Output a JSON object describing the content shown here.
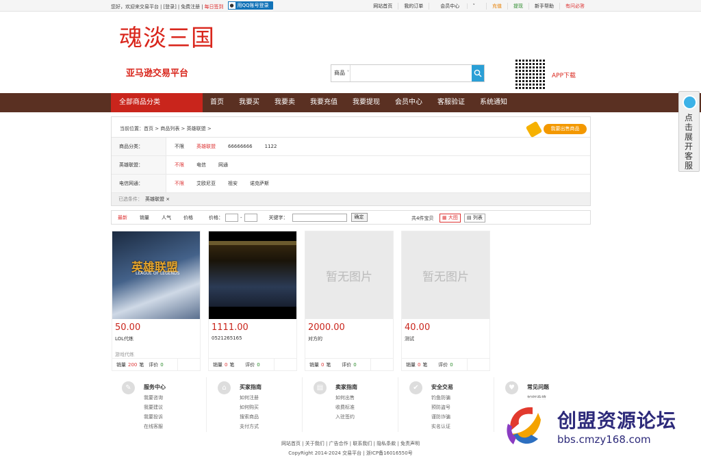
{
  "topbar": {
    "welcome": "您好，欢迎来交易平台",
    "login": "[登录]",
    "register": "免费注册",
    "daily": "每日签到",
    "qq_login": "用QQ账号登录",
    "links": [
      "网站首页",
      "我的订单",
      "会员中心",
      "充值",
      "提现",
      "新手帮助",
      "有问必答"
    ]
  },
  "header": {
    "logo": "魂淡三国",
    "subtitle": "亚马逊交易平台",
    "search_scope": "商品",
    "search_placeholder": "",
    "app_download": "APP下载"
  },
  "nav": {
    "category_label": "全部商品分类",
    "items": [
      "首页",
      "我要买",
      "我要卖",
      "我要充值",
      "我要提现",
      "会员中心",
      "客服验证",
      "系统通知"
    ]
  },
  "breadcrumb": "当前位置：首页 > 商品列表 > 英雄联盟 >",
  "sell_button": "我要出售商品",
  "filters": [
    {
      "key": "商品分类：",
      "values": [
        "不限",
        "英雄联盟",
        "66666666",
        "1122"
      ],
      "active": 1
    },
    {
      "key": "英雄联盟：",
      "values": [
        "不限",
        "电信",
        "网通"
      ],
      "active": 0
    },
    {
      "key": "电信网通：",
      "values": [
        "不限",
        "艾欧尼亚",
        "祖安",
        "诺克萨斯"
      ],
      "active": 0
    }
  ],
  "selected": {
    "label": "已选条件：",
    "tag": "英雄联盟 ×"
  },
  "sorter": {
    "tabs": [
      "最新",
      "销量",
      "人气",
      "价格"
    ],
    "price_label": "价格：",
    "dash": "-",
    "keyword_label": "关键字：",
    "confirm": "确定",
    "count": "共4件宝贝",
    "view_grid": "▦ 大图",
    "view_list": "▤ 列表"
  },
  "products": [
    {
      "price": "50.00",
      "name": "LOL代练",
      "tag": "游戏代练",
      "sales_label": "销量",
      "sales": "200",
      "sales_unit": "笔",
      "rating_label": "评价",
      "rating": "0",
      "image": "lol",
      "img_text": "英雄联盟",
      "img_sub": "LEAGUE OF LEGENDS"
    },
    {
      "price": "1111.00",
      "name": "0521265165",
      "tag": "",
      "sales_label": "销量",
      "sales": "0",
      "sales_unit": "笔",
      "rating_label": "评价",
      "rating": "0",
      "image": "screenshot",
      "img_text": "",
      "img_sub": ""
    },
    {
      "price": "2000.00",
      "name": "对方的",
      "tag": "",
      "sales_label": "销量",
      "sales": "0",
      "sales_unit": "笔",
      "rating_label": "评价",
      "rating": "0",
      "image": "none",
      "img_text": "暂无图片",
      "img_sub": ""
    },
    {
      "price": "40.00",
      "name": "测试",
      "tag": "",
      "sales_label": "销量",
      "sales": "0",
      "sales_unit": "笔",
      "rating_label": "评价",
      "rating": "0",
      "image": "none",
      "img_text": "暂无图片",
      "img_sub": ""
    }
  ],
  "footer_cols": [
    {
      "icon": "✎",
      "title": "服务中心",
      "items": [
        "我要咨询",
        "我要建议",
        "我要投诉",
        "在线客服"
      ]
    },
    {
      "icon": "⌂",
      "title": "买家指南",
      "items": [
        "如何注册",
        "如何购买",
        "搜索商品",
        "支付方式"
      ]
    },
    {
      "icon": "▤",
      "title": "卖家指南",
      "items": [
        "如何出售",
        "收费标准",
        "入驻签约"
      ]
    },
    {
      "icon": "✔",
      "title": "安全交易",
      "items": [
        "钓鱼防骗",
        "预防盗号",
        "谨防诈骗",
        "实名认证"
      ]
    },
    {
      "icon": "♥",
      "title": "常见问题",
      "items": [
        "如何充值"
      ]
    }
  ],
  "bottom_links": "网站首页 | 关于我们 | 广告合作 | 联系我们 | 隐私条款 | 免责声明",
  "copyright": "CopyRight 2014-2024 交易平台 | 浙ICP备16016550号",
  "side_service": "点击展开客服",
  "watermark": {
    "title": "创盟资源论坛",
    "url": "bbs.cmzy168.com"
  },
  "colors": {
    "brand_red": "#c9251c",
    "nav_brown": "#5a3022",
    "search_blue": "#2a9fd6"
  }
}
